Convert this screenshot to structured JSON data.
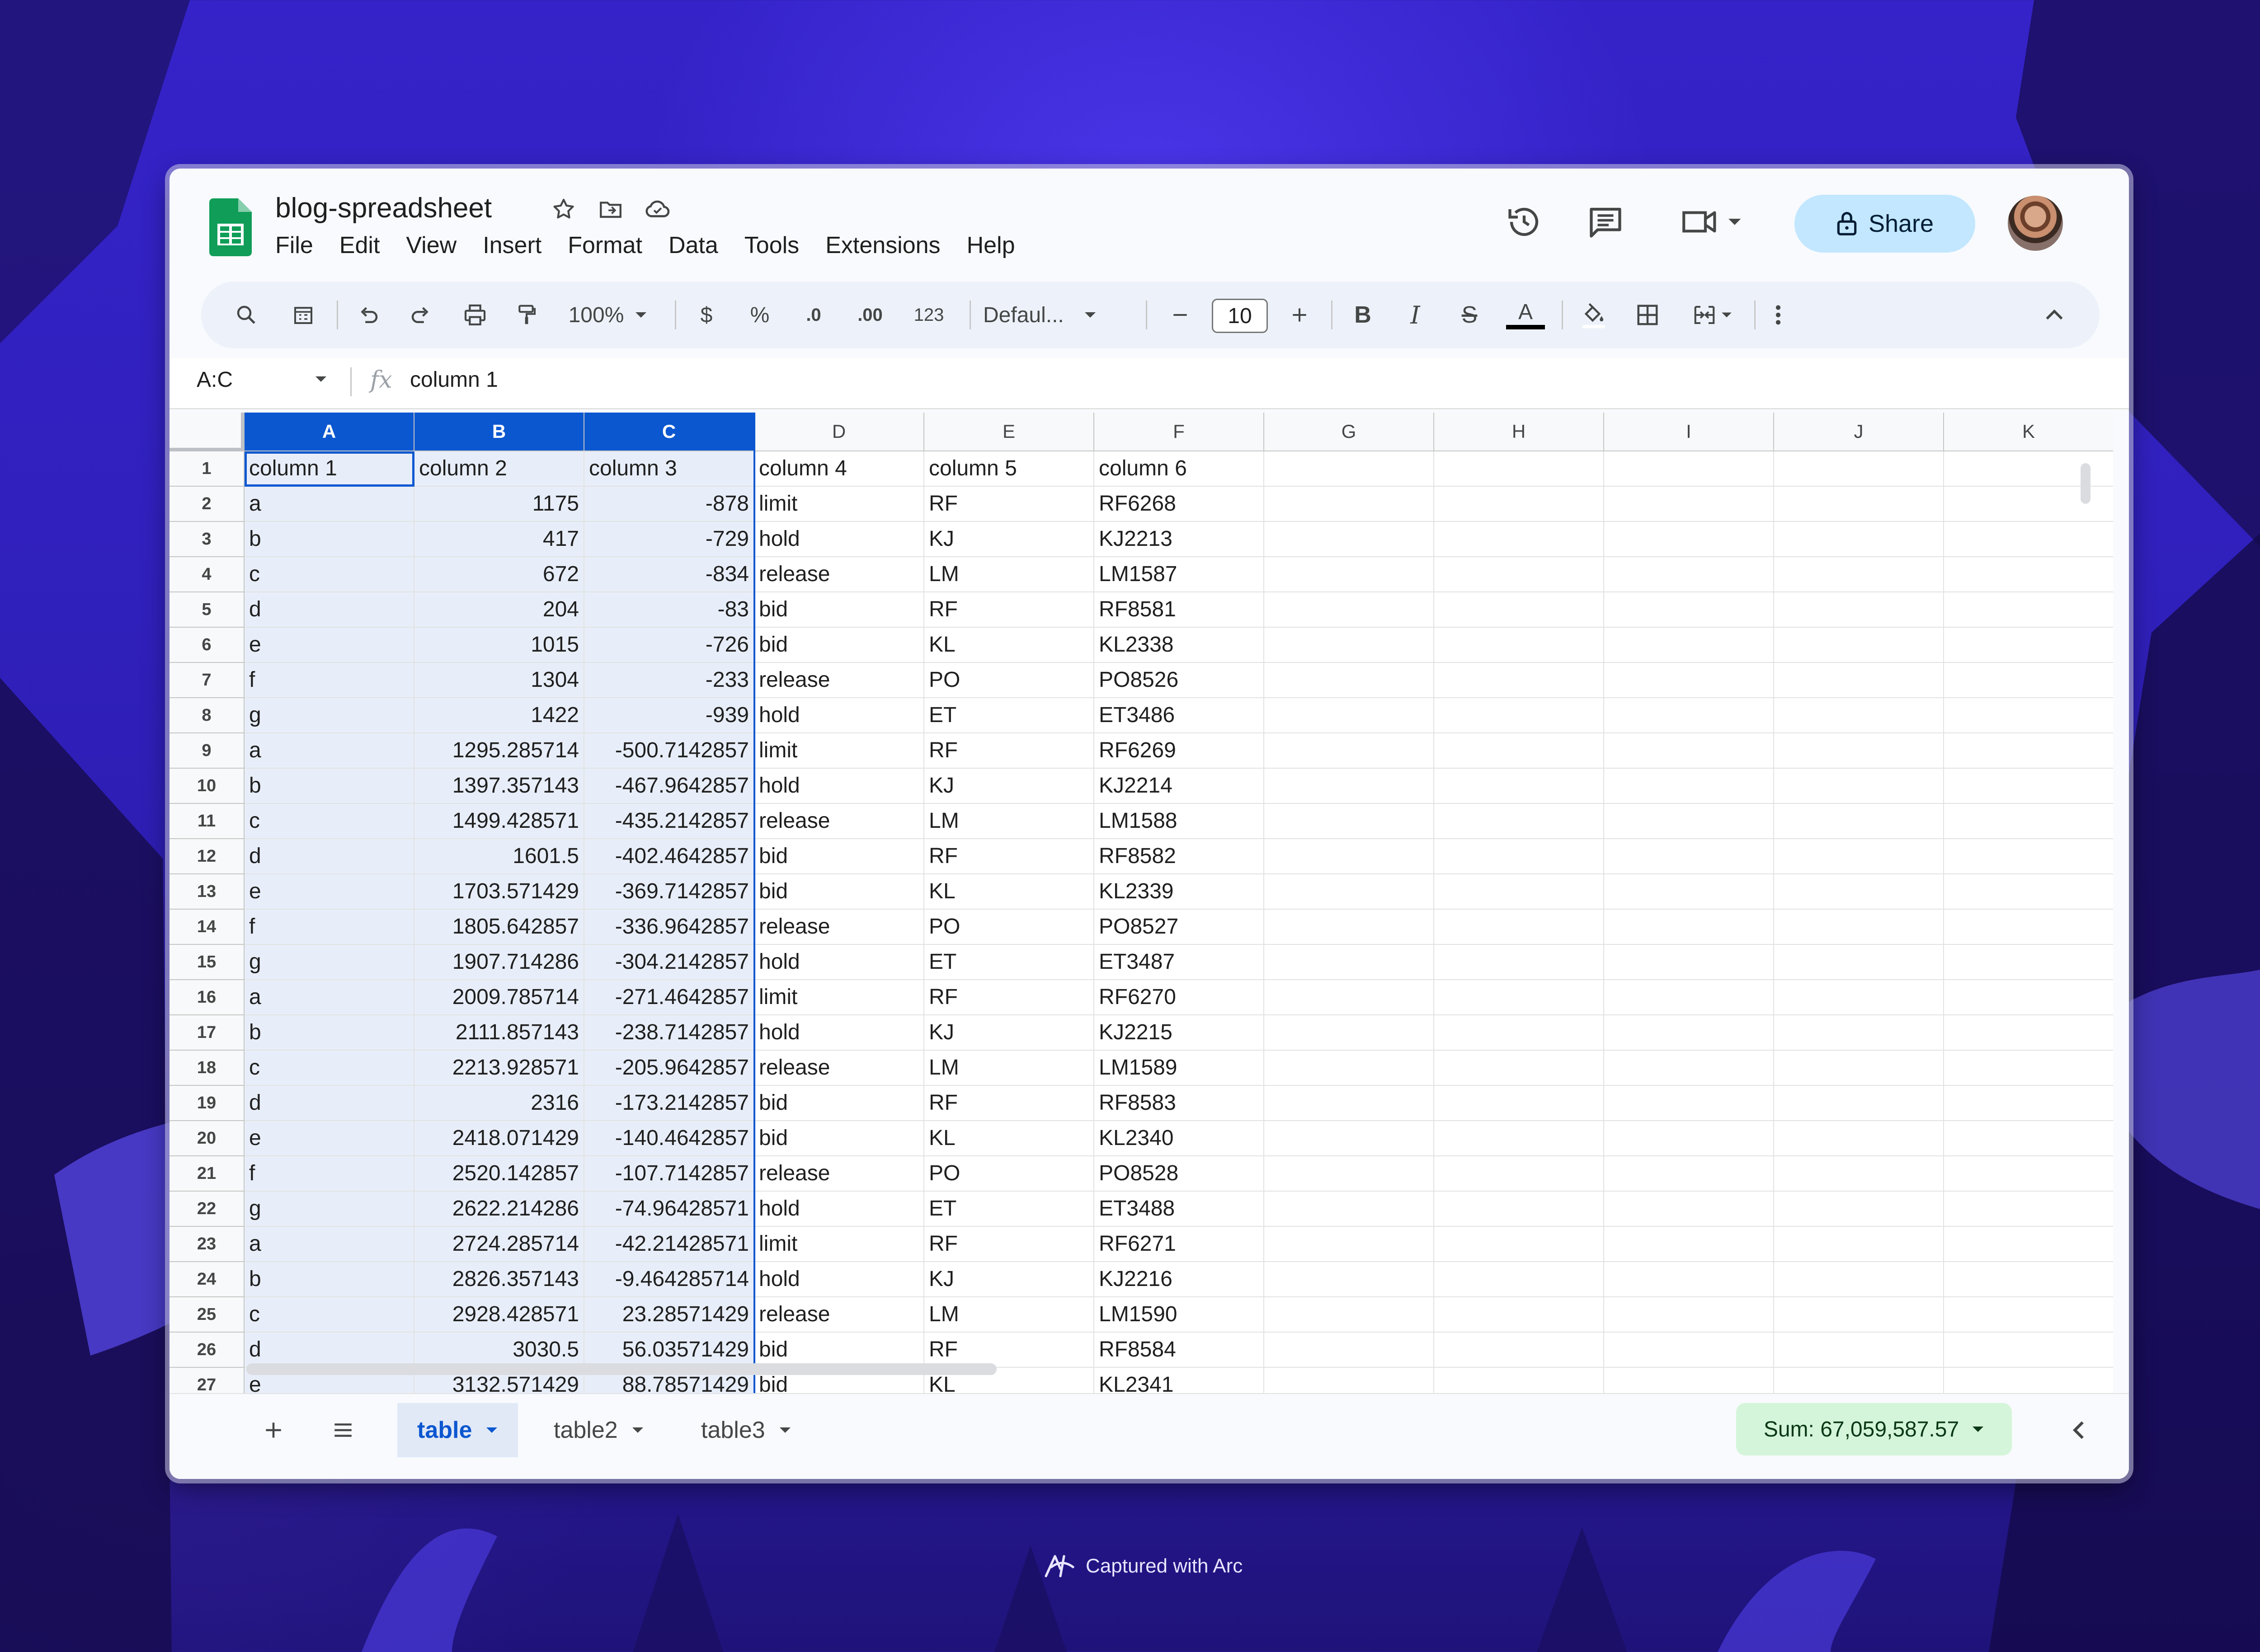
{
  "document": {
    "title": "blog-spreadsheet"
  },
  "menu": [
    "File",
    "Edit",
    "View",
    "Insert",
    "Format",
    "Data",
    "Tools",
    "Extensions",
    "Help"
  ],
  "header": {
    "share_label": "Share"
  },
  "toolbar": {
    "zoom": "100%",
    "currency": "$",
    "percent": "%",
    "decrease_decimal": ".0",
    "increase_decimal": ".00",
    "number_format": "123",
    "font": "Defaul...",
    "font_size": "10",
    "bold": "B",
    "italic": "I",
    "strikethrough": "S",
    "text_color_label": "A"
  },
  "formula_bar": {
    "name_box": "A:C",
    "fx_label": "fx",
    "content": "column 1"
  },
  "grid": {
    "columns": [
      "A",
      "B",
      "C",
      "D",
      "E",
      "F",
      "G",
      "H",
      "I",
      "J",
      "K"
    ],
    "selected_columns": [
      "A",
      "B",
      "C"
    ],
    "row_numbers": [
      "1",
      "2",
      "3",
      "4",
      "5",
      "6",
      "7",
      "8",
      "9",
      "10",
      "11",
      "12",
      "13",
      "14",
      "15",
      "16",
      "17",
      "18",
      "19",
      "20",
      "21",
      "22",
      "23",
      "24",
      "25",
      "26",
      "27"
    ],
    "rows": [
      [
        "column 1",
        "column 2",
        "column 3",
        "column 4",
        "column 5",
        "column 6"
      ],
      [
        "a",
        "1175",
        "-878",
        "limit",
        "RF",
        "RF6268"
      ],
      [
        "b",
        "417",
        "-729",
        "hold",
        "KJ",
        "KJ2213"
      ],
      [
        "c",
        "672",
        "-834",
        "release",
        "LM",
        "LM1587"
      ],
      [
        "d",
        "204",
        "-83",
        "bid",
        "RF",
        "RF8581"
      ],
      [
        "e",
        "1015",
        "-726",
        "bid",
        "KL",
        "KL2338"
      ],
      [
        "f",
        "1304",
        "-233",
        "release",
        "PO",
        "PO8526"
      ],
      [
        "g",
        "1422",
        "-939",
        "hold",
        "ET",
        "ET3486"
      ],
      [
        "a",
        "1295.285714",
        "-500.7142857",
        "limit",
        "RF",
        "RF6269"
      ],
      [
        "b",
        "1397.357143",
        "-467.9642857",
        "hold",
        "KJ",
        "KJ2214"
      ],
      [
        "c",
        "1499.428571",
        "-435.2142857",
        "release",
        "LM",
        "LM1588"
      ],
      [
        "d",
        "1601.5",
        "-402.4642857",
        "bid",
        "RF",
        "RF8582"
      ],
      [
        "e",
        "1703.571429",
        "-369.7142857",
        "bid",
        "KL",
        "KL2339"
      ],
      [
        "f",
        "1805.642857",
        "-336.9642857",
        "release",
        "PO",
        "PO8527"
      ],
      [
        "g",
        "1907.714286",
        "-304.2142857",
        "hold",
        "ET",
        "ET3487"
      ],
      [
        "a",
        "2009.785714",
        "-271.4642857",
        "limit",
        "RF",
        "RF6270"
      ],
      [
        "b",
        "2111.857143",
        "-238.7142857",
        "hold",
        "KJ",
        "KJ2215"
      ],
      [
        "c",
        "2213.928571",
        "-205.9642857",
        "release",
        "LM",
        "LM1589"
      ],
      [
        "d",
        "2316",
        "-173.2142857",
        "bid",
        "RF",
        "RF8583"
      ],
      [
        "e",
        "2418.071429",
        "-140.4642857",
        "bid",
        "KL",
        "KL2340"
      ],
      [
        "f",
        "2520.142857",
        "-107.7142857",
        "release",
        "PO",
        "PO8528"
      ],
      [
        "g",
        "2622.214286",
        "-74.96428571",
        "hold",
        "ET",
        "ET3488"
      ],
      [
        "a",
        "2724.285714",
        "-42.21428571",
        "limit",
        "RF",
        "RF6271"
      ],
      [
        "b",
        "2826.357143",
        "-9.464285714",
        "hold",
        "KJ",
        "KJ2216"
      ],
      [
        "c",
        "2928.428571",
        "23.28571429",
        "release",
        "LM",
        "LM1590"
      ],
      [
        "d",
        "3030.5",
        "56.03571429",
        "bid",
        "RF",
        "RF8584"
      ],
      [
        "e",
        "3132.571429",
        "88.78571429",
        "bid",
        "KL",
        "KL2341"
      ]
    ]
  },
  "sheets": {
    "tabs": [
      {
        "label": "table",
        "active": true
      },
      {
        "label": "table2",
        "active": false
      },
      {
        "label": "table3",
        "active": false
      }
    ],
    "sum_label": "Sum: 67,059,587.57"
  },
  "footer": {
    "captured_label": "Captured with Arc"
  },
  "colors": {
    "accent": "#0b57d0",
    "share_bg": "#c2e7ff",
    "sum_bg": "#d4f5d9",
    "sheets_green": "#0f9d58",
    "background": "#3523c9"
  }
}
